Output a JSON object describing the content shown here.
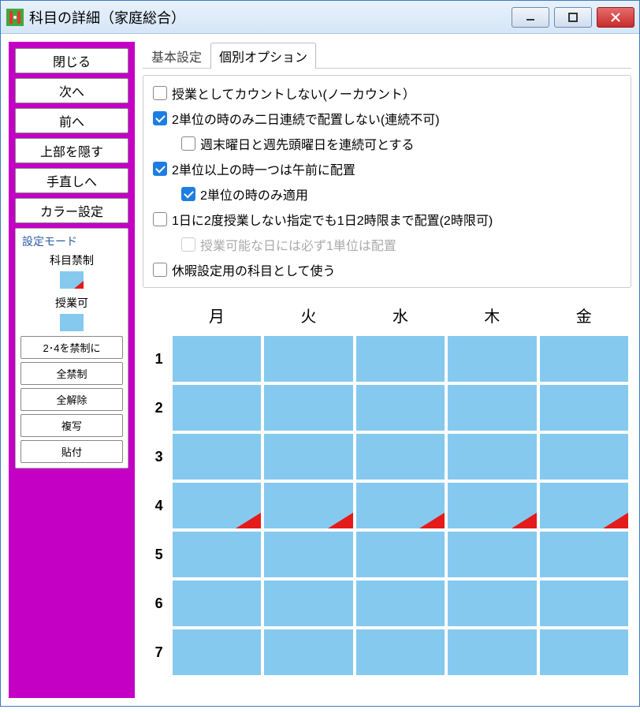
{
  "window": {
    "title": "科目の詳細（家庭総合）"
  },
  "sidebar": {
    "buttons": {
      "close": "閉じる",
      "next": "次へ",
      "prev": "前へ",
      "hide_top": "上部を隠す",
      "to_manual": "手直しへ",
      "color_setting": "カラー設定"
    },
    "panel": {
      "legend": "設定モード",
      "mode_label_forbidden": "科目禁制",
      "mode_label_allowed": "授業可",
      "btn_forbid24": "2･4を禁制に",
      "btn_forbid_all": "全禁制",
      "btn_clear_all": "全解除",
      "btn_copy": "複写",
      "btn_paste": "貼付"
    }
  },
  "tabs": {
    "basic": "基本設定",
    "individual": "個別オプション"
  },
  "options": {
    "no_count": "授業としてカウントしない(ノーカウント）",
    "no_consecutive_2units": "2単位の時のみ二日連続で配置しない(連続不可)",
    "allow_weekend_consecutive": "週末曜日と週先頭曜日を連続可とする",
    "one_morning_2plus": "2単位以上の時一つは午前に配置",
    "only_2units": "2単位の時のみ適用",
    "allow_2per_day": "1日に2度授業しない指定でも1日2時限まで配置(2時限可)",
    "must_one_on_possible_day": "授業可能な日には必ず1単位は配置",
    "use_as_holiday": "休暇設定用の科目として使う"
  },
  "option_states": {
    "no_count": false,
    "no_consecutive_2units": true,
    "allow_weekend_consecutive": false,
    "one_morning_2plus": true,
    "only_2units": true,
    "allow_2per_day": false,
    "must_one_on_possible_day": false,
    "use_as_holiday": false
  },
  "schedule": {
    "days": [
      "月",
      "火",
      "水",
      "木",
      "金"
    ],
    "periods": [
      "1",
      "2",
      "3",
      "4",
      "5",
      "6",
      "7"
    ],
    "forbidden": {
      "4": [
        "月",
        "火",
        "水",
        "木",
        "金"
      ]
    }
  }
}
